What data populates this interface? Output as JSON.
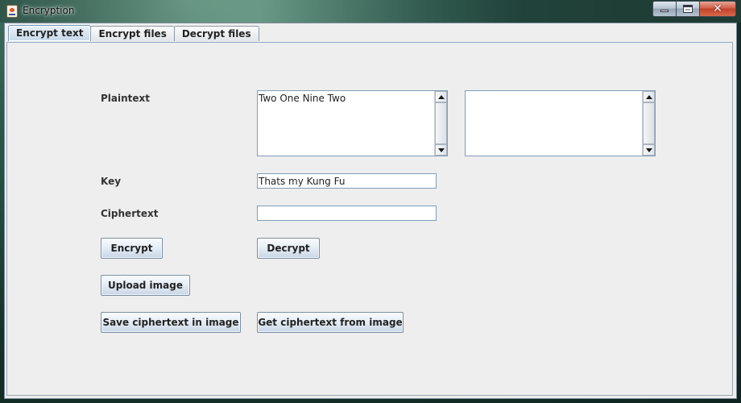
{
  "window": {
    "title": "Encryption",
    "icon": "java-cup-icon"
  },
  "tabs": [
    {
      "label": "Encrypt text",
      "active": true
    },
    {
      "label": "Encrypt files",
      "active": false
    },
    {
      "label": "Decrypt files",
      "active": false
    }
  ],
  "form": {
    "plaintext_label": "Plaintext",
    "plaintext_value": "Two One Nine Two",
    "output_value": "",
    "key_label": "Key",
    "key_value": "Thats my Kung Fu",
    "ciphertext_label": "Ciphertext",
    "ciphertext_value": ""
  },
  "buttons": {
    "encrypt": "Encrypt",
    "decrypt": "Decrypt",
    "upload_image": "Upload image",
    "save_in_image": "Save ciphertext in image",
    "get_from_image": "Get ciphertext from image"
  },
  "colors": {
    "active_tab": "#c7d9ea",
    "panel_bg": "#eeeeee",
    "close_button": "#c0412a"
  }
}
